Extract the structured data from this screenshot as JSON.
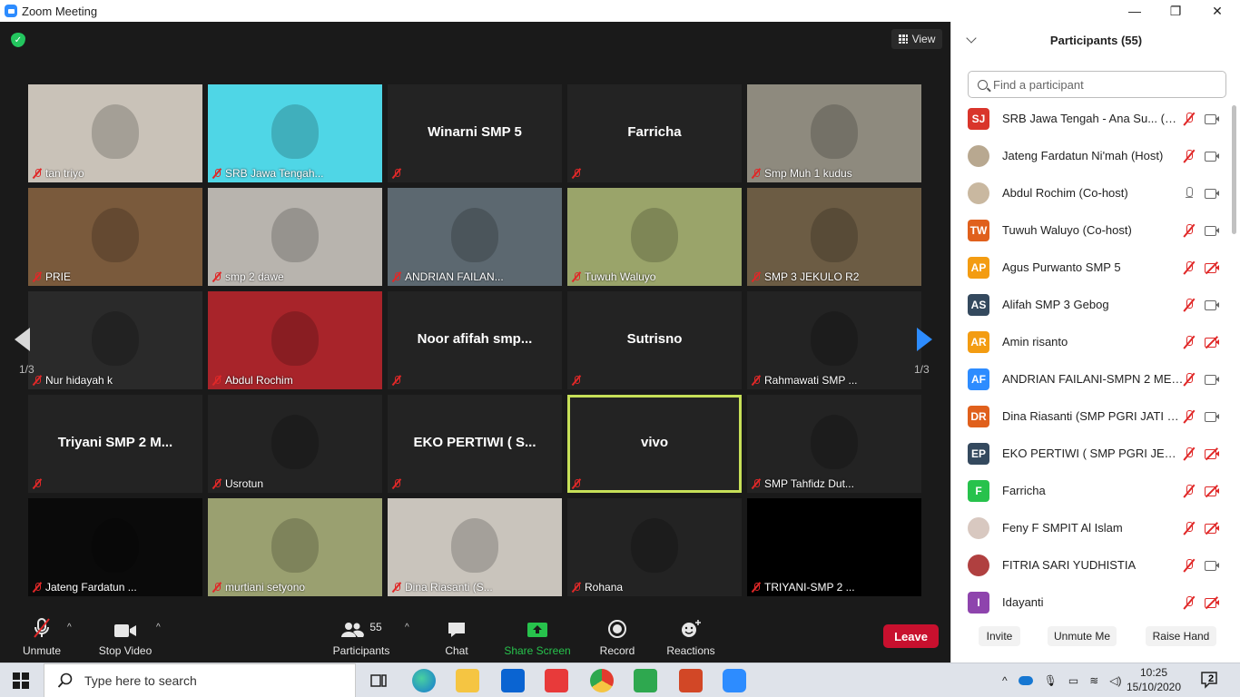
{
  "window": {
    "title": "Zoom Meeting",
    "minimize": "—",
    "restore": "❐",
    "close": "✕"
  },
  "meeting": {
    "view_label": "View",
    "page_left": "1/3",
    "page_right": "1/3",
    "tiles": [
      {
        "name": "tan triyo",
        "video": true,
        "bg": "#c9c2b8"
      },
      {
        "name": "SRB Jawa Tengah...",
        "video": true,
        "bg": "#4fd6e6"
      },
      {
        "name": "",
        "center": "Winarni SMP 5",
        "video": false
      },
      {
        "name": "",
        "center": "Farricha",
        "video": false
      },
      {
        "name": "Smp Muh 1 kudus",
        "video": true,
        "bg": "#8e8a7e"
      },
      {
        "name": "PRIE",
        "video": true,
        "bg": "#7a5a3c"
      },
      {
        "name": "smp 2 dawe",
        "video": true,
        "bg": "#b8b4ae"
      },
      {
        "name": "ANDRIAN FAILAN...",
        "video": true,
        "bg": "#5c6870"
      },
      {
        "name": "Tuwuh Waluyo",
        "video": true,
        "bg": "#9aa46a"
      },
      {
        "name": "SMP 3 JEKULO R2",
        "video": true,
        "bg": "#6c5c44"
      },
      {
        "name": "Nur hidayah k",
        "video": true,
        "bg": "#2a2a2a"
      },
      {
        "name": "Abdul Rochim",
        "video": true,
        "bg": "#a8242a"
      },
      {
        "name": "",
        "center": "Noor afifah smp...",
        "video": false
      },
      {
        "name": "",
        "center": "Sutrisno",
        "video": false
      },
      {
        "name": "Rahmawati SMP ...",
        "video": true,
        "bg": "#232323"
      },
      {
        "name": "",
        "center": "Triyani SMP 2 M...",
        "video": false
      },
      {
        "name": "Usrotun",
        "video": true,
        "bg": "#232323"
      },
      {
        "name": "",
        "center": "EKO PERTIWI ( S...",
        "video": false
      },
      {
        "name": "",
        "center": "vivo",
        "video": false,
        "active": true
      },
      {
        "name": "SMP Tahfidz Dut...",
        "video": true,
        "bg": "#232323"
      },
      {
        "name": "Jateng Fardatun ...",
        "video": true,
        "bg": "#0a0a0a"
      },
      {
        "name": "murtiani setyono",
        "video": true,
        "bg": "#9aa070"
      },
      {
        "name": "Dina Riasanti (S...",
        "video": true,
        "bg": "#c9c4bc"
      },
      {
        "name": "Rohana",
        "video": true,
        "bg": "#232323"
      },
      {
        "name": "TRIYANI-SMP 2 ...",
        "video": true,
        "bg": "#000000"
      }
    ]
  },
  "toolbar": {
    "unmute": "Unmute",
    "stop_video": "Stop Video",
    "participants": "Participants",
    "participants_count": "55",
    "chat": "Chat",
    "share_screen": "Share Screen",
    "record": "Record",
    "reactions": "Reactions",
    "leave": "Leave"
  },
  "panel": {
    "title": "Participants (55)",
    "search_placeholder": "Find a participant",
    "participants": [
      {
        "initials": "SJ",
        "color": "#d9352b",
        "name": "SRB Jawa Tengah - Ana Su...  (Me)",
        "mic": "muted",
        "cam": "on"
      },
      {
        "initials": "",
        "color": "#b8a890",
        "name": "Jateng Fardatun Ni'mah (Host)",
        "mic": "muted",
        "cam": "on"
      },
      {
        "initials": "",
        "color": "#c9b8a0",
        "name": "Abdul Rochim (Co-host)",
        "mic": "live",
        "cam": "on"
      },
      {
        "initials": "TW",
        "color": "#e0601c",
        "name": "Tuwuh Waluyo (Co-host)",
        "mic": "muted",
        "cam": "on"
      },
      {
        "initials": "AP",
        "color": "#f39c12",
        "name": "Agus Purwanto SMP 5",
        "mic": "muted",
        "cam": "off"
      },
      {
        "initials": "AS",
        "color": "#34495e",
        "name": "Alifah SMP 3 Gebog",
        "mic": "muted",
        "cam": "on"
      },
      {
        "initials": "AR",
        "color": "#f39c12",
        "name": "Amin risanto",
        "mic": "muted",
        "cam": "off"
      },
      {
        "initials": "AF",
        "color": "#2d8cff",
        "name": "ANDRIAN FAILANI-SMPN 2 MEJ...",
        "mic": "muted",
        "cam": "on"
      },
      {
        "initials": "DR",
        "color": "#e0601c",
        "name": "Dina Riasanti (SMP PGRI JATI K...",
        "mic": "muted",
        "cam": "on"
      },
      {
        "initials": "EP",
        "color": "#34495e",
        "name": "EKO PERTIWI ( SMP PGRI JEKUL...",
        "mic": "muted",
        "cam": "off"
      },
      {
        "initials": "F",
        "color": "#27c24c",
        "name": "Farricha",
        "mic": "muted",
        "cam": "off"
      },
      {
        "initials": "",
        "color": "#d8c8c0",
        "name": "Feny F SMPIT Al Islam",
        "mic": "muted",
        "cam": "off"
      },
      {
        "initials": "",
        "color": "#b04040",
        "name": "FITRIA SARI YUDHISTIA",
        "mic": "muted",
        "cam": "on"
      },
      {
        "initials": "I",
        "color": "#8e44ad",
        "name": "Idayanti",
        "mic": "muted",
        "cam": "off"
      }
    ],
    "invite": "Invite",
    "unmute_me": "Unmute Me",
    "raise_hand": "Raise Hand"
  },
  "taskbar": {
    "search_placeholder": "Type here to search",
    "time": "10:25",
    "date": "15/10/2020",
    "notifications": "2"
  }
}
